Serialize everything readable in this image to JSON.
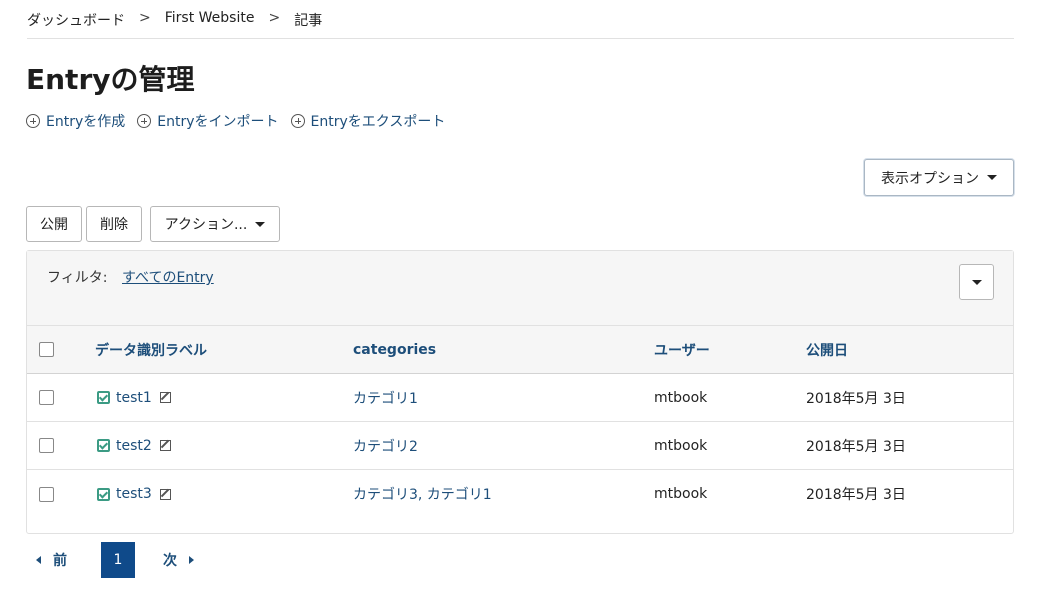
{
  "breadcrumb": {
    "items": [
      "ダッシュボード",
      "First Website",
      "記事"
    ],
    "separator": ">"
  },
  "page_title": "Entryの管理",
  "actions": {
    "create": "Entryを作成",
    "import": "Entryをインポート",
    "export": "Entryをエクスポート"
  },
  "display_options": {
    "label": "表示オプション"
  },
  "toolbar": {
    "publish": "公開",
    "delete": "削除",
    "actions": "アクション..."
  },
  "filter": {
    "label": "フィルタ:",
    "value": "すべてのEntry"
  },
  "table": {
    "headers": {
      "label": "データ識別ラベル",
      "categories": "categories",
      "user": "ユーザー",
      "published": "公開日"
    },
    "rows": [
      {
        "label": "test1",
        "categories": "カテゴリ1",
        "user": "mtbook",
        "date": "2018年5月 3日"
      },
      {
        "label": "test2",
        "categories": "カテゴリ2",
        "user": "mtbook",
        "date": "2018年5月 3日"
      },
      {
        "label": "test3",
        "categories": "カテゴリ3, カテゴリ1",
        "user": "mtbook",
        "date": "2018年5月 3日"
      }
    ]
  },
  "pagination": {
    "prev": "前",
    "current": "1",
    "next": "次"
  },
  "colors": {
    "link": "#1d4e7a",
    "accent": "#0f4a8a",
    "status": "#3b9b84"
  }
}
